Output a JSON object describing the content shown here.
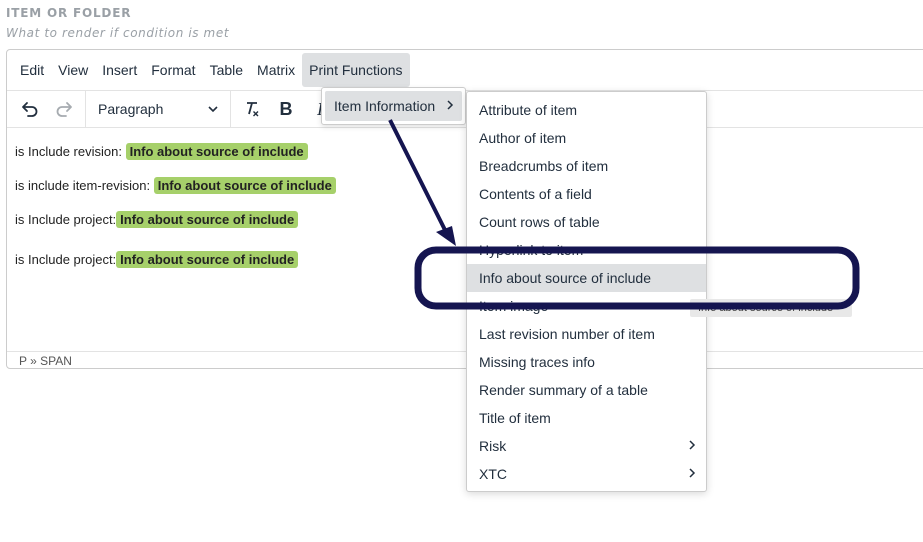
{
  "field": {
    "label": "ITEM OR FOLDER",
    "sublabel": "What to render if condition is met"
  },
  "menubar": {
    "items": [
      "Edit",
      "View",
      "Insert",
      "Format",
      "Table",
      "Matrix",
      "Print Functions"
    ]
  },
  "toolbar": {
    "block_format": "Paragraph",
    "icons": [
      "undo-icon",
      "redo-icon",
      "clear-formatting-icon",
      "bold-icon",
      "italic-icon"
    ]
  },
  "content": {
    "lines": [
      {
        "label": "is Include revision:",
        "tag": "Info about source of include"
      },
      {
        "label": "is include item-revision:",
        "tag": "Info about source of include"
      },
      {
        "label": "is Include project:",
        "tag": "Info about source of include"
      },
      {
        "label": "is Include project:",
        "tag": "Info about source of include"
      }
    ]
  },
  "statusbar": {
    "path": "P » SPAN"
  },
  "submenu_level1": {
    "label": "Item Information"
  },
  "submenu_level2": {
    "items": [
      "Attribute of item",
      "Author of item",
      "Breadcrumbs of item",
      "Contents of a field",
      "Count rows of table",
      "Hyperlink to item",
      "Info about source of include",
      "Item image",
      "Last revision number of item",
      "Missing traces info",
      "Render summary of a table",
      "Title of item",
      "Risk",
      "XTC"
    ],
    "selected": "Info about source of include"
  },
  "tooltip": {
    "text": "Info about source of include"
  },
  "colors": {
    "highlight": "#a6d06a",
    "annotation": "#151550",
    "menu_hover": "#dee0e2"
  }
}
